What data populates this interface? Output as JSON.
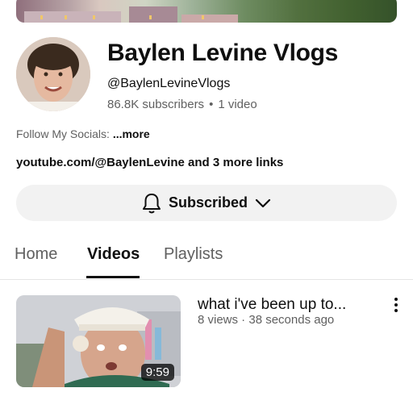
{
  "channel": {
    "name": "Baylen Levine Vlogs",
    "handle": "@BaylenLevineVlogs",
    "subscribers": "86.8K subscribers",
    "separator": "•",
    "video_count": "1 video",
    "description": "Follow My Socials:",
    "more_label": "...more",
    "links": "youtube.com/@BaylenLevine and 3 more links"
  },
  "subscribe_button": {
    "label": "Subscribed",
    "icon": "bell-icon",
    "dropdown_icon": "chevron-down-icon"
  },
  "tabs": [
    {
      "label": "Home",
      "active": false
    },
    {
      "label": "Videos",
      "active": true
    },
    {
      "label": "Playlists",
      "active": false
    }
  ],
  "videos": [
    {
      "title": "what i've been up to...",
      "meta": "8 views · 38 seconds ago",
      "duration": "9:59"
    }
  ],
  "colors": {
    "text_primary": "#0f0f0f",
    "text_secondary": "#606060",
    "button_bg": "#f2f2f2"
  }
}
